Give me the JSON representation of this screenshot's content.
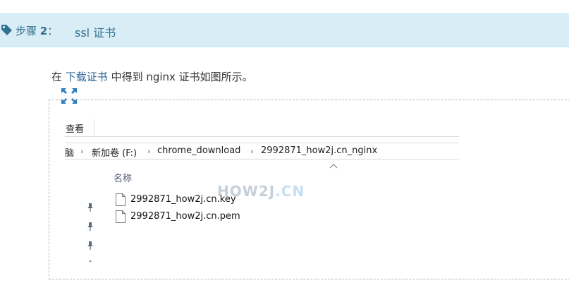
{
  "step": {
    "prefix": "步骤",
    "number": "2",
    "colon": "：",
    "title": "ssl 证书"
  },
  "intro": {
    "before": "在 ",
    "link": "下载证书",
    "after": " 中得到 nginx 证书如图所示。"
  },
  "explorer": {
    "menu_view": "查看",
    "address": [
      "脑",
      "新加卷 (F:)",
      "chrome_download",
      "2992871_how2j.cn_nginx"
    ],
    "address_separator": "›",
    "column_name": "名称",
    "files": [
      "2992871_how2j.cn.key",
      "2992871_how2j.cn.pem"
    ],
    "watermark": {
      "main": "HOW2J",
      "suffix": ".CN"
    }
  },
  "colors": {
    "step_bar_bg": "#d9edf7",
    "step_text": "#31708f",
    "link": "#2a6496"
  }
}
